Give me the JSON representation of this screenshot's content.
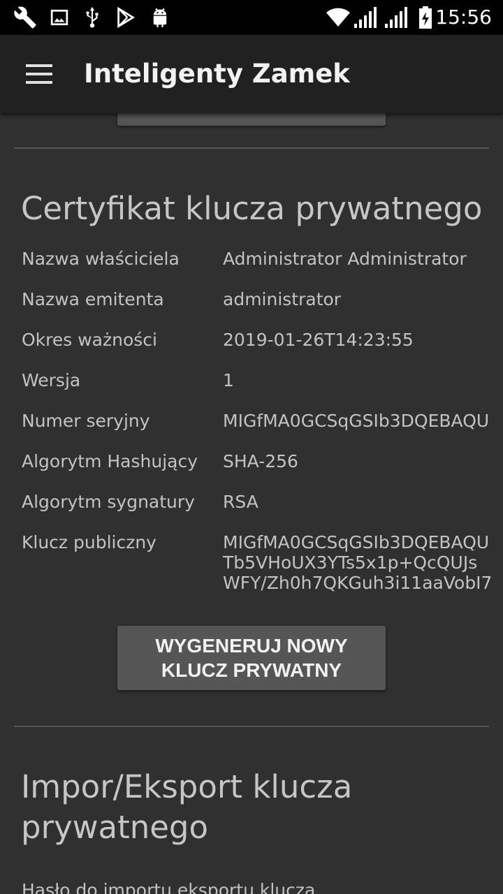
{
  "status_bar": {
    "time": "15:56",
    "icons_left": [
      "wrench-icon",
      "image-icon",
      "usb-icon",
      "play-store-icon",
      "android-icon"
    ],
    "icons_right": [
      "wifi-icon",
      "signal-icon",
      "signal-icon",
      "battery-charging-icon"
    ]
  },
  "app_bar": {
    "title": "Inteligenty Zamek",
    "menu_icon": "hamburger-menu-icon"
  },
  "certificate": {
    "title": "Certyfikat klucza prywatnego",
    "rows": [
      {
        "label": "Nazwa właściciela",
        "value": "Administrator Administrator"
      },
      {
        "label": "Nazwa emitenta",
        "value": "administrator"
      },
      {
        "label": "Okres ważności",
        "value": "2019-01-26T14:23:55"
      },
      {
        "label": "Wersja",
        "value": "1"
      },
      {
        "label": "Numer seryjny",
        "value": "MIGfMA0GCSqGSIb3DQEBAQU"
      },
      {
        "label": "Algorytm Hashujący",
        "value": "SHA-256"
      },
      {
        "label": "Algorytm sygnatury",
        "value": "RSA"
      }
    ],
    "public_key": {
      "label": "Klucz publiczny",
      "lines": [
        "MIGfMA0GCSqGSIb3DQEBAQU",
        "Tb5VHoUX3YTs5x1p+QcQUJs",
        "WFY/Zh0h7QKGuh3i11aaVobI7"
      ]
    },
    "generate_button": {
      "line1": "WYGENERUJ NOWY",
      "line2": "KLUCZ PRYWATNY"
    }
  },
  "import_export": {
    "title_line1": "Impor/Eksport klucza",
    "title_line2": "prywatnego",
    "partial_text": "Hasło do importu eksportu klucza"
  },
  "colors": {
    "background": "#303030",
    "app_bar": "#212121",
    "button": "#565656",
    "text": "#c3c3c3"
  }
}
